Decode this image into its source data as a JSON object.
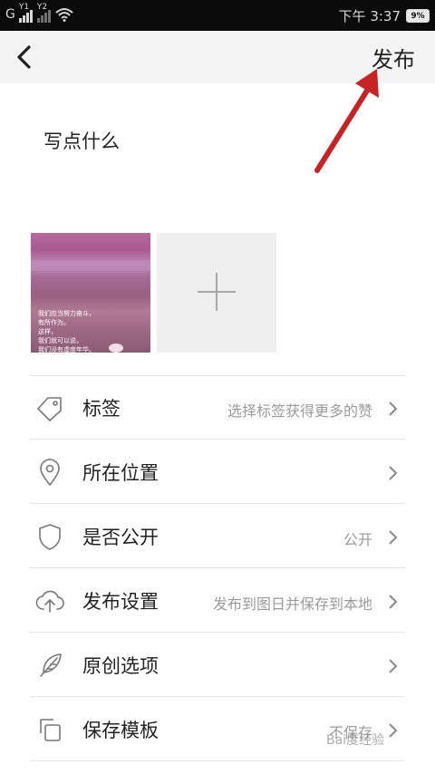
{
  "status_bar": {
    "carrier_letter": "G",
    "sim1": "Y1",
    "sim2": "Y2",
    "time": "下午 3:37",
    "battery": "9%"
  },
  "nav": {
    "back_icon": "chevron-left-icon",
    "publish_label": "发布"
  },
  "compose": {
    "placeholder": "写点什么"
  },
  "images": {
    "thumbnail_text": "我们应当努力奋斗，\n有所作为。\n这样，\n我们就可以说，\n我们没有虚度年华。",
    "add_icon": "plus-icon"
  },
  "menu": [
    {
      "id": "tags",
      "icon": "tag-icon",
      "label": "标签",
      "value": "选择标签获得更多的赞"
    },
    {
      "id": "location",
      "icon": "location-pin-icon",
      "label": "所在位置",
      "value": ""
    },
    {
      "id": "public",
      "icon": "shield-icon",
      "label": "是否公开",
      "value": "公开"
    },
    {
      "id": "publish-settings",
      "icon": "cloud-upload-icon",
      "label": "发布设置",
      "value": "发布到图日并保存到本地"
    },
    {
      "id": "original",
      "icon": "feather-icon",
      "label": "原创选项",
      "value": ""
    },
    {
      "id": "save-template",
      "icon": "copy-icon",
      "label": "保存模板",
      "value": "不保存"
    }
  ],
  "watermark": "Bai度经验",
  "colors": {
    "status_bar_bg": "#0b0b0b",
    "nav_bg": "#f4f4f4",
    "annotation_arrow": "#c62424"
  }
}
